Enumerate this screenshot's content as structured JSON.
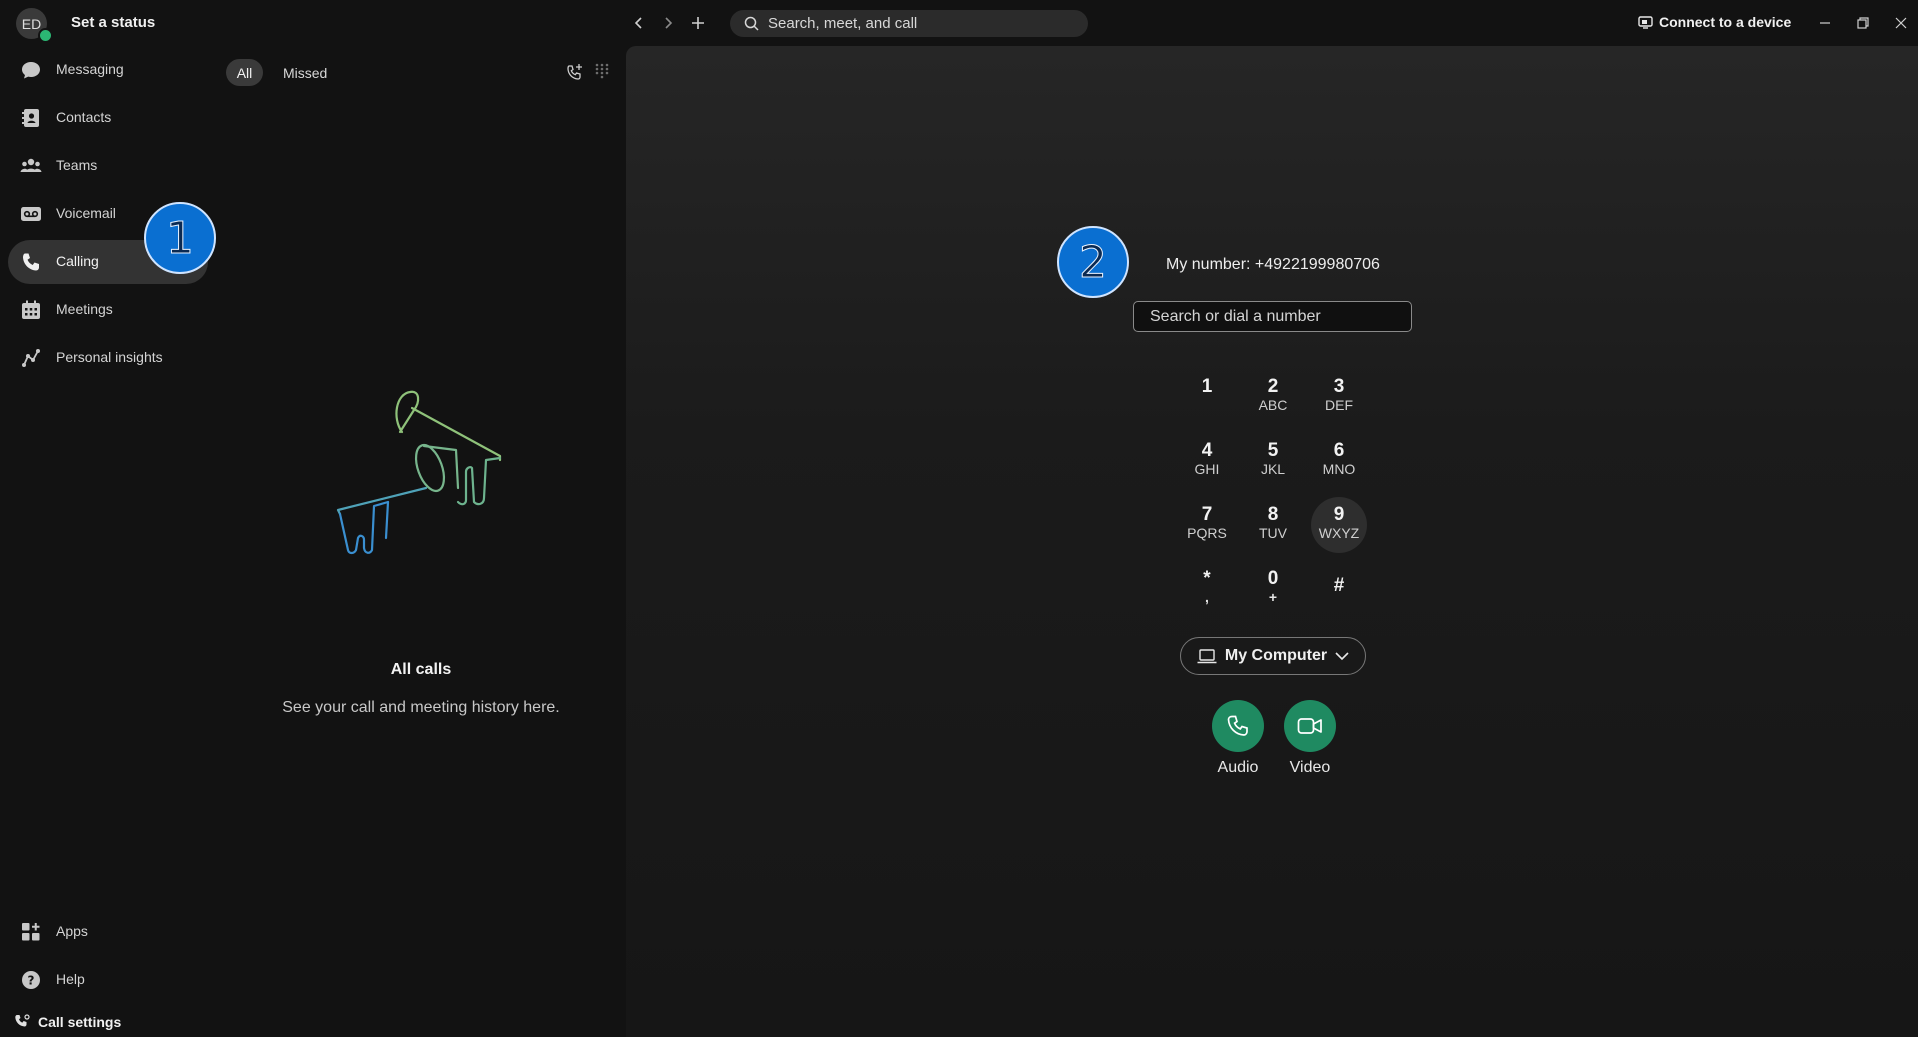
{
  "header": {
    "avatar_initials": "ED",
    "status": "Set a status",
    "search_placeholder": "Search, meet, and call",
    "connect_device": "Connect to a device"
  },
  "sidebar": {
    "items": [
      {
        "label": "Messaging",
        "icon": "chat-bubble-icon"
      },
      {
        "label": "Contacts",
        "icon": "contacts-book-icon"
      },
      {
        "label": "Teams",
        "icon": "people-group-icon"
      },
      {
        "label": "Voicemail",
        "icon": "voicemail-icon"
      },
      {
        "label": "Calling",
        "icon": "phone-icon",
        "active": true
      },
      {
        "label": "Meetings",
        "icon": "calendar-icon"
      },
      {
        "label": "Personal insights",
        "icon": "insights-icon"
      }
    ],
    "bottom": {
      "apps": "Apps",
      "help": "Help",
      "call_settings": "Call settings"
    }
  },
  "calls_panel": {
    "filters": [
      "All",
      "Missed"
    ],
    "active_filter": "All",
    "empty_title": "All calls",
    "empty_subtitle": "See your call and meeting history here."
  },
  "dialer": {
    "my_number": "My number: +4922199980706",
    "input_placeholder": "Search or dial a number",
    "keys": [
      {
        "digit": "1",
        "letters": ""
      },
      {
        "digit": "2",
        "letters": "ABC"
      },
      {
        "digit": "3",
        "letters": "DEF"
      },
      {
        "digit": "4",
        "letters": "GHI"
      },
      {
        "digit": "5",
        "letters": "JKL"
      },
      {
        "digit": "6",
        "letters": "MNO"
      },
      {
        "digit": "7",
        "letters": "PQRS"
      },
      {
        "digit": "8",
        "letters": "TUV"
      },
      {
        "digit": "9",
        "letters": "WXYZ"
      },
      {
        "digit": "*",
        "letters": ","
      },
      {
        "digit": "0",
        "letters": "+"
      },
      {
        "digit": "#",
        "letters": ""
      }
    ],
    "device": "My Computer",
    "audio_label": "Audio",
    "video_label": "Video"
  },
  "markers": [
    "1",
    "2"
  ],
  "colors": {
    "background": "#121212",
    "accent_green": "#1f8a61",
    "marker_blue": "#0a6fd1",
    "presence_green": "#2bb673"
  }
}
